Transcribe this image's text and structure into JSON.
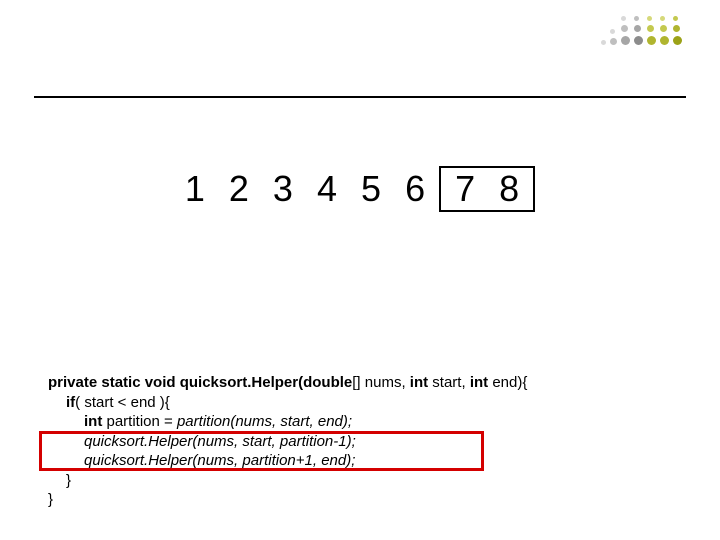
{
  "numbers": {
    "n1": "1",
    "n2": "2",
    "n3": "3",
    "n4": "4",
    "n5": "5",
    "n6": "6",
    "n7": "7",
    "n8": "8"
  },
  "code": {
    "sig_private_static_void": "private static void ",
    "sig_fn": "quicksort.Helper(",
    "sig_double": "double",
    "sig_after_double": "[] nums, ",
    "sig_int1": "int ",
    "sig_start": "start, ",
    "sig_int2": "int ",
    "sig_end": "end){",
    "if_kw": "if",
    "if_rest": "( start < end ){",
    "int_kw": "int ",
    "part_assign": "partition = ",
    "part_call": "partition(nums, start, end);",
    "rec1_fn": "quicksort.Helper(nums, start, partition-1);",
    "rec2_fn": "quicksort.Helper(nums, partition+1, end);",
    "close1": "}",
    "close2": "}"
  }
}
